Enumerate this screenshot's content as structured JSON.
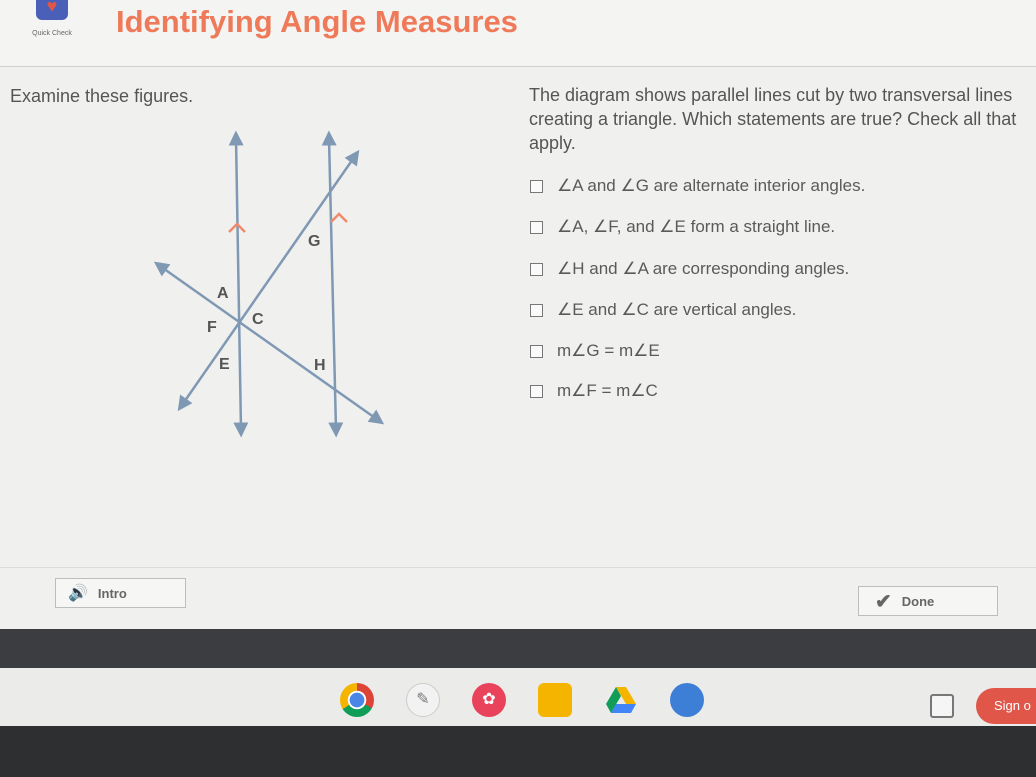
{
  "app": {
    "logo_text": "Quick Check",
    "title": "Identifying Angle Measures"
  },
  "left": {
    "prompt": "Examine these figures."
  },
  "diagram": {
    "labels": [
      "A",
      "F",
      "C",
      "E",
      "G",
      "H"
    ]
  },
  "question": {
    "text": "The diagram shows parallel lines cut by two transversal lines creating a triangle. Which statements are true? Check all that apply."
  },
  "options": [
    {
      "label": "∠A and ∠G are alternate interior angles.",
      "checked": false
    },
    {
      "label": "∠A, ∠F, and ∠E form a straight line.",
      "checked": false
    },
    {
      "label": "∠H and ∠A are corresponding angles.",
      "checked": false
    },
    {
      "label": "∠E and ∠C are vertical angles.",
      "checked": false
    },
    {
      "label": "m∠G = m∠E",
      "checked": false
    },
    {
      "label": "m∠F = m∠C",
      "checked": false
    }
  ],
  "buttons": {
    "intro": "Intro",
    "done": "Done"
  },
  "shelf": {
    "sign_in": "Sign o",
    "icons": [
      "chrome-icon",
      "pen-icon",
      "palette-icon",
      "slides-icon",
      "drive-icon",
      "card-icon"
    ]
  },
  "colors": {
    "title": "#ef7a5a",
    "diagram_lines": "#7f98b4",
    "parallel_marks": "#ef8a6a"
  }
}
